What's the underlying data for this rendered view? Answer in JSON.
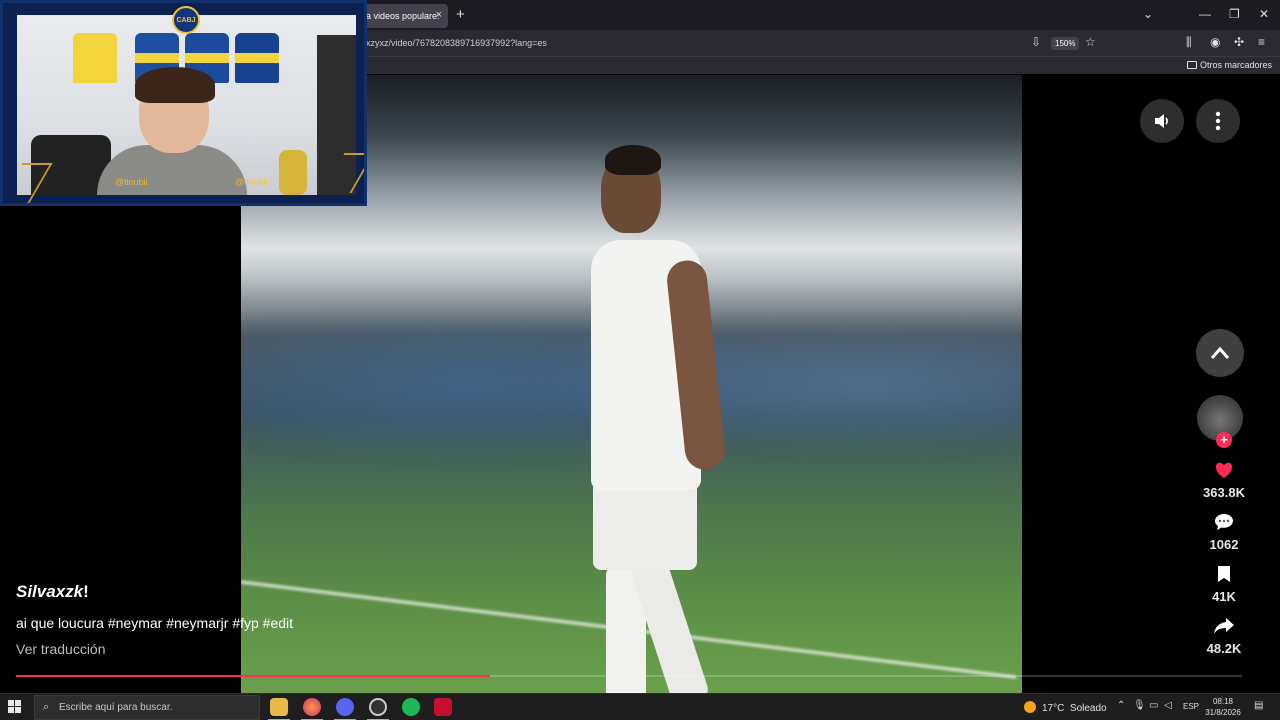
{
  "browser": {
    "tab_title": "a videos populare:",
    "tab_close": "×",
    "new_tab": "+",
    "url": "xzyxz/video/7678208389716937992?lang=es",
    "zoom": "150%",
    "bookmark_folder": "Otros marcadores",
    "window_controls": {
      "menu": "⌄",
      "minimize": "—",
      "restore": "❐",
      "close": "✕"
    }
  },
  "webcam": {
    "crest_text": "CABJ",
    "handle_1": "@tinubii",
    "handle_2": "@tinubii"
  },
  "video": {
    "author": "Silvaxzk",
    "author_suffix": "!",
    "description": "ai que loucura #neymar #neymarjr #fyp #edit",
    "translate_label": "Ver traducción",
    "progress": 0.387,
    "accent_color": "#fe2c55"
  },
  "actions": {
    "likes": "363.8K",
    "comments": "1062",
    "saves": "41K",
    "shares": "48.2K",
    "follow_symbol": "+"
  },
  "taskbar": {
    "search_placeholder": "Escribe aquí para buscar.",
    "temperature": "17°C",
    "weather": "Soleado",
    "language": "ESP",
    "time": "08:18",
    "date": "31/8/2026"
  }
}
